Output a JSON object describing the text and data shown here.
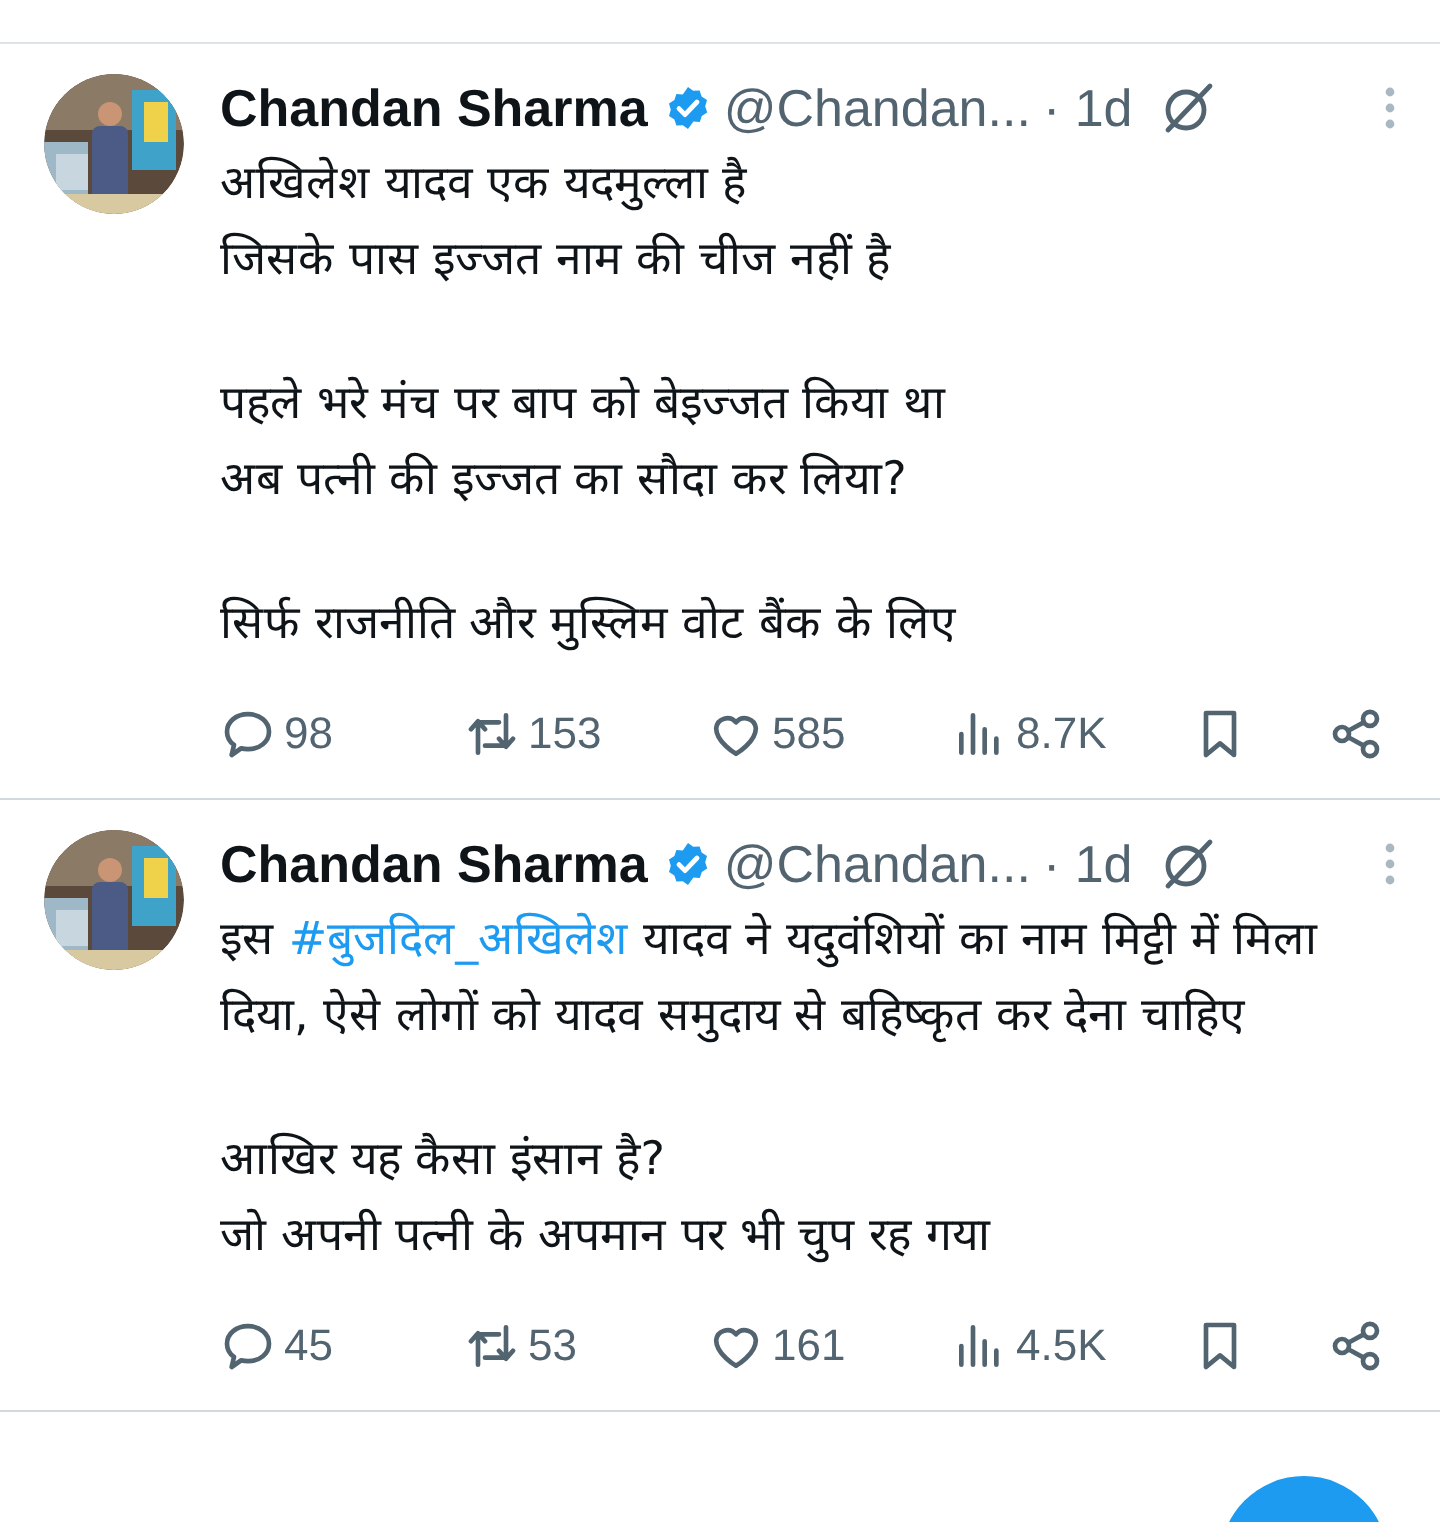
{
  "tweets": [
    {
      "name": "Chandan Sharma",
      "handle": "@Chandan...",
      "time": "· 1d",
      "verified": true,
      "paragraphs": [
        [
          {
            "text": "अखिलेश यादव एक यदमुल्ला है"
          },
          {
            "text": "जिसके पास इज्जत नाम की चीज नहीं है"
          }
        ],
        [
          {
            "text": "पहले भरे मंच पर बाप को बेइज्जत किया था"
          },
          {
            "text": "अब पत्नी की इज्जत का सौदा कर लिया?"
          }
        ],
        [
          {
            "text": "सिर्फ राजनीति और मुस्लिम वोट बैंक के लिए"
          }
        ]
      ],
      "stats": {
        "replies": "98",
        "reposts": "153",
        "likes": "585",
        "views": "8.7K"
      }
    },
    {
      "name": "Chandan Sharma",
      "handle": "@Chandan...",
      "time": "· 1d",
      "verified": true,
      "paragraphs": [
        [
          {
            "parts": [
              {
                "kind": "text",
                "text": "इस "
              },
              {
                "kind": "hashtag",
                "text": "#बुजदिल_अखिलेश"
              },
              {
                "kind": "text",
                "text": " यादव ने यदुवंशियों का नाम मिट्टी में मिला दिया, ऐसे लोगों को यादव समुदाय से बहिष्कृत कर देना चाहिए"
              }
            ]
          }
        ],
        [
          {
            "text": "आखिर यह कैसा इंसान है?"
          },
          {
            "text": "जो अपनी पत्नी के अपमान पर भी चुप रह गया"
          }
        ]
      ],
      "stats": {
        "replies": "45",
        "reposts": "53",
        "likes": "161",
        "views": "4.5K"
      }
    }
  ]
}
